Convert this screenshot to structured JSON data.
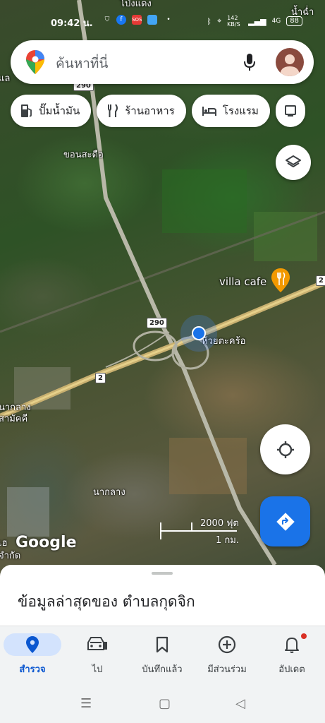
{
  "status_bar": {
    "time": "09:42 น.",
    "net_speed": "142 KB/S",
    "network": "4G",
    "battery": "88"
  },
  "search": {
    "placeholder": "ค้นหาที่นี่"
  },
  "chips": [
    {
      "label": "ปั๊มน้ำมัน",
      "icon": "gas-station-icon"
    },
    {
      "label": "ร้านอาหาร",
      "icon": "restaurant-icon"
    },
    {
      "label": "โรงแรม",
      "icon": "hotel-icon"
    }
  ],
  "map": {
    "labels": {
      "top_left": "โป่งแดง",
      "top_right": "น้ำฉ่ำ",
      "left_edge": "แล",
      "khon_sa_tue": "ขอนสะตือ",
      "huai_ta_khro": "ห้วยตะคร้อ",
      "na_klang_top": "นากลาง",
      "sam_khi": "สามัคคี",
      "na_klang_town": "นากลาง",
      "bottom_left_1": "เฮ",
      "bottom_left_2": "จำกัด"
    },
    "shields": {
      "route_290_top": "290",
      "route_290_mid": "290",
      "route_2_left": "2",
      "route_2_right": "2"
    },
    "place": {
      "name": "villa cafe",
      "icon": "restaurant-icon"
    },
    "scale": {
      "feet": "2000 ฟุต",
      "km": "1 กม."
    },
    "attribution": "Google"
  },
  "sheet": {
    "title": "ข้อมูลล่าสุดของ ตำบลกุดจิก"
  },
  "bottom_nav": [
    {
      "label": "สำรวจ",
      "icon": "explore-pin-icon",
      "active": true
    },
    {
      "label": "ไป",
      "icon": "car-icon",
      "active": false
    },
    {
      "label": "บันทึกแล้ว",
      "icon": "bookmark-icon",
      "active": false
    },
    {
      "label": "มีส่วนร่วม",
      "icon": "contribute-icon",
      "active": false
    },
    {
      "label": "อัปเดต",
      "icon": "bell-icon",
      "active": false
    }
  ],
  "colors": {
    "accent": "#1a73e8",
    "active_nav_bg": "#d3e3fd",
    "place_pin": "#f29900",
    "notification_dot": "#d93025"
  }
}
